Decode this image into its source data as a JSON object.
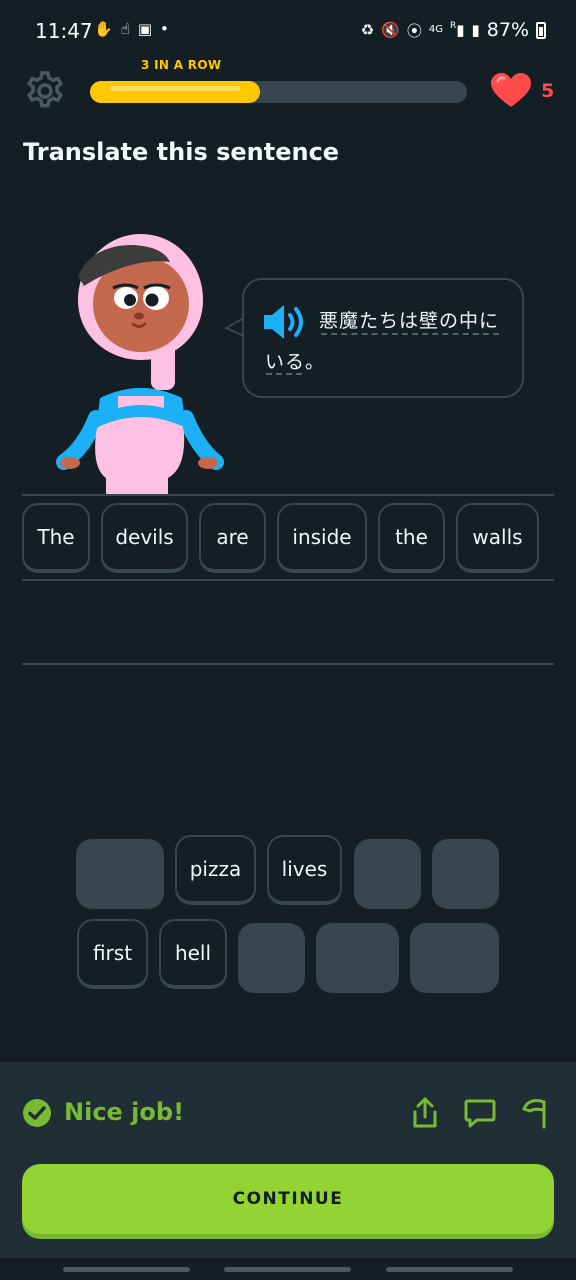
{
  "status_bar": {
    "time": "11:47",
    "battery_percent": "87%",
    "left_icons": [
      "notification-icon",
      "hand-icon",
      "app-icon",
      "dot-icon"
    ],
    "right_icons": [
      "recycle-icon",
      "mute-icon",
      "location-icon",
      "4g-icon",
      "signal-r-icon",
      "signal-icon"
    ],
    "network_label": "4G",
    "signal_label": "R"
  },
  "top_bar": {
    "streak_label": "3 IN A ROW",
    "progress_fraction": 0.45,
    "hearts": "5",
    "colors": {
      "progress": "#ffc800",
      "heart": "#ff4b4b"
    }
  },
  "prompt": {
    "title": "Translate this sentence",
    "japanese_line1": "悪魔たちは壁の中に",
    "japanese_line2": "いる。"
  },
  "answer_words": [
    "The",
    "devils",
    "are",
    "inside",
    "the",
    "walls"
  ],
  "word_bank": {
    "row1": [
      "",
      "pizza",
      "lives",
      "",
      ""
    ],
    "row2": [
      "first",
      "hell",
      "",
      "",
      ""
    ]
  },
  "footer": {
    "feedback": "Nice job!",
    "continue_label": "CONTINUE",
    "icons": [
      "share-icon",
      "comment-icon",
      "flag-icon"
    ],
    "colors": {
      "success": "#79b933",
      "button": "#93d333"
    }
  }
}
